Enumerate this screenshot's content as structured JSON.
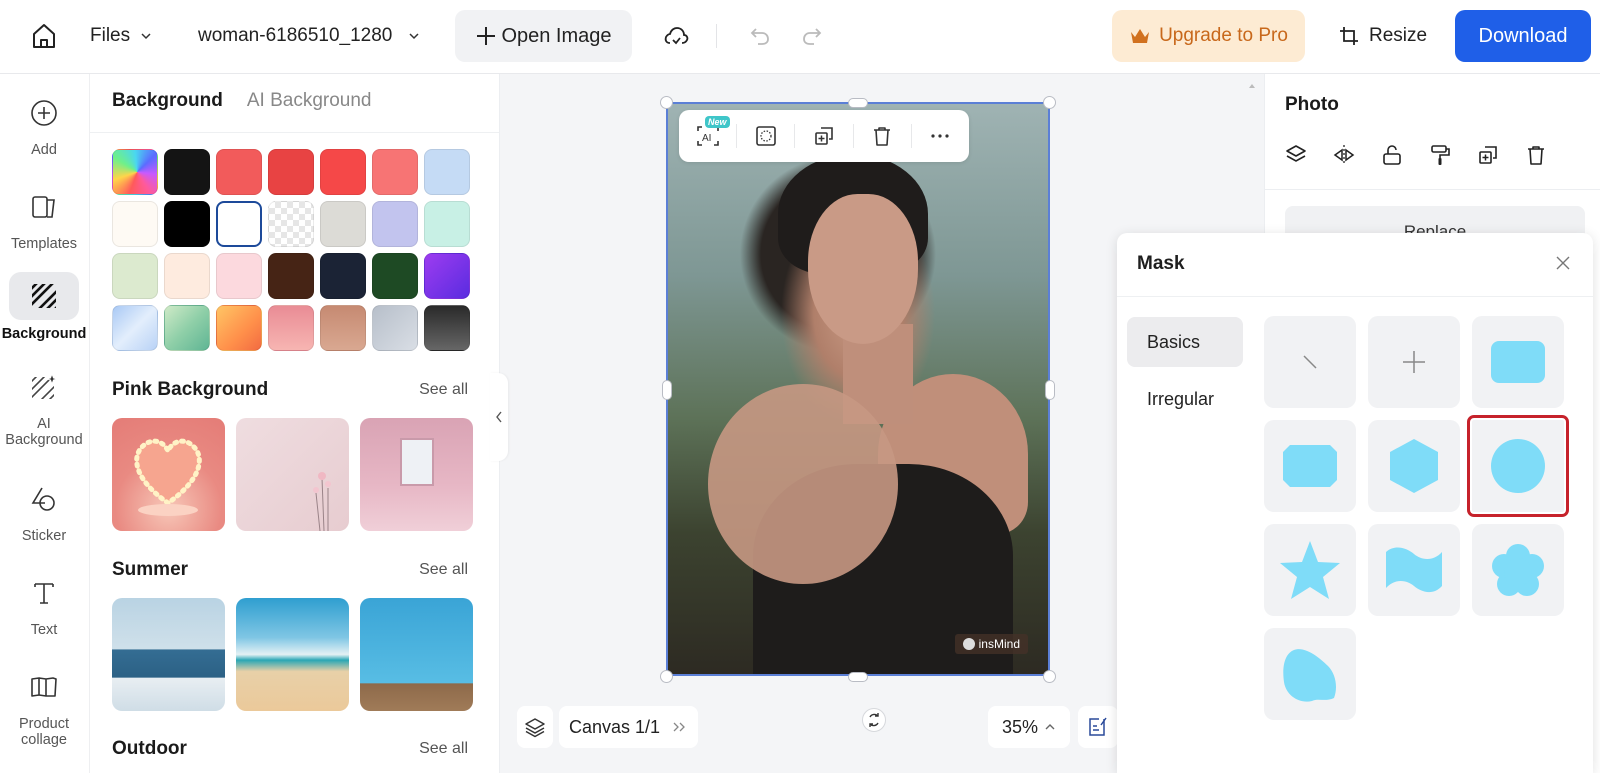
{
  "topbar": {
    "files_label": "Files",
    "file_name": "woman-6186510_1280",
    "open_image_label": "Open Image",
    "upgrade_label": "Upgrade to Pro",
    "resize_label": "Resize",
    "download_label": "Download",
    "colors": {
      "download_bg": "#1f5fe8",
      "upgrade_bg": "#fdebd3",
      "upgrade_text": "#c8681b"
    }
  },
  "leftnav": {
    "items": [
      {
        "label": "Add",
        "icon": "plus-circle-icon"
      },
      {
        "label": "Templates",
        "icon": "templates-icon"
      },
      {
        "label": "Background",
        "icon": "background-stripes-icon",
        "active": true
      },
      {
        "label": "AI Background",
        "icon": "ai-background-icon"
      },
      {
        "label": "Sticker",
        "icon": "sticker-icon"
      },
      {
        "label": "Text",
        "icon": "text-icon"
      },
      {
        "label": "Product collage",
        "icon": "collage-icon"
      }
    ]
  },
  "bgpanel": {
    "tabs": [
      {
        "label": "Background",
        "active": true
      },
      {
        "label": "AI Background",
        "active": false
      }
    ],
    "swatches": [
      "rainbow",
      "#141414",
      "#f25b5b",
      "#e84343",
      "#f54848",
      "#f77474",
      "#c5dbf5",
      "#fefaf4",
      "#000000",
      "#ffffff",
      "transparent",
      "#dcdbd6",
      "#c2c4ee",
      "#c8f0e5",
      "#dceacf",
      "#feebdf",
      "#fcd9de",
      "#462415",
      "#1b2335",
      "#1e4a24",
      "purple-gradient",
      "blue-gradient",
      "green-gradient",
      "orange-gradient",
      "pink-gradient",
      "tan-gradient",
      "silver-gradient",
      "dark-gradient"
    ],
    "selected_swatch": "#ffffff",
    "sections": [
      {
        "title": "Pink Background",
        "see_all": "See all",
        "thumbs": [
          "heart-lights",
          "pink-wall-flowers",
          "pink-curtain-window"
        ]
      },
      {
        "title": "Summer",
        "see_all": "See all",
        "thumbs": [
          "ocean-horizon",
          "sandy-beach",
          "swimming-pool"
        ]
      },
      {
        "title": "Outdoor",
        "see_all": "See all"
      }
    ]
  },
  "canvas": {
    "toolbar": {
      "new_badge": "New",
      "ai_label": "AI"
    },
    "watermark": "insMind",
    "pager_label": "Canvas 1/1",
    "zoom_label": "35%"
  },
  "rightpanel": {
    "title": "Photo",
    "replace_label": "Replace"
  },
  "mask": {
    "title": "Mask",
    "categories": [
      {
        "label": "Basics",
        "active": true
      },
      {
        "label": "Irregular",
        "active": false
      }
    ],
    "shapes": [
      "none",
      "add",
      "rounded-rectangle",
      "octagon",
      "hexagon",
      "circle",
      "star",
      "wave-flag",
      "flower",
      "blob"
    ],
    "highlighted_shape": "circle",
    "shape_color": "#7fdcf8"
  }
}
